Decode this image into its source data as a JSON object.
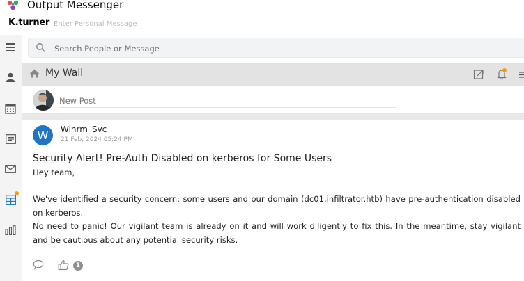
{
  "app": {
    "title": "Output Messenger"
  },
  "user": {
    "name": "K.turner",
    "personal_message_placeholder": "Enter Personal Message"
  },
  "search": {
    "placeholder": "Search People or Message"
  },
  "sidebar": {
    "items": [
      {
        "icon": "menu-icon"
      },
      {
        "icon": "contacts-icon"
      },
      {
        "icon": "calendar-icon"
      },
      {
        "icon": "notes-icon"
      },
      {
        "icon": "mail-icon"
      },
      {
        "icon": "wall-icon",
        "active": true,
        "notification": true
      },
      {
        "icon": "stats-icon"
      }
    ]
  },
  "wall": {
    "title": "My Wall",
    "new_post_placeholder": "New Post"
  },
  "post": {
    "avatar_letter": "W",
    "author": "Winrm_Svc",
    "timestamp": "21 Feb, 2024 05:24 PM",
    "title": "Security Alert! Pre-Auth Disabled on kerberos for Some Users",
    "greeting": "Hey team,",
    "paragraph_1": "We've identified a security concern: some users and our domain (dc01.infiltrator.htb) have pre-authentication disabled on kerberos.",
    "paragraph_2": "No need to panic! Our vigilant team is already on it and will work diligently to fix this. In the meantime, stay vigilant and be cautious about any potential security risks.",
    "like_count": "1"
  },
  "colors": {
    "accent": "#1f74c4",
    "notification": "#f39c12",
    "header_bg": "#e3e3e3"
  }
}
